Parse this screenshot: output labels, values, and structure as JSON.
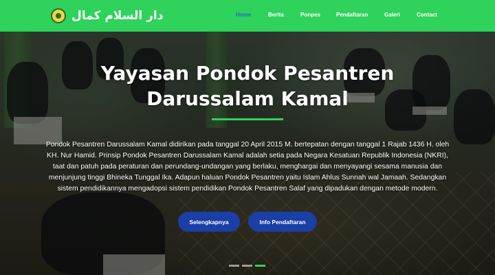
{
  "navbar": {
    "brand_text": "دار السلام كمال",
    "items": [
      {
        "label": "Home",
        "active": true
      },
      {
        "label": "Berita",
        "active": false
      },
      {
        "label": "Ponpes",
        "active": false
      },
      {
        "label": "Pendaftaran",
        "active": false
      },
      {
        "label": "Galeri",
        "active": false
      },
      {
        "label": "Contact",
        "active": false
      }
    ]
  },
  "hero": {
    "title_line1": "Yayasan Pondok Pesantren",
    "title_line2": "Darussalam Kamal",
    "description": "Pondok Pesantren Darussalam Kamal didirikan pada tanggal 20 April 2015 M. bertepatan dengan tanggal 1 Rajab 1436 H. oleh KH. Nur Hamid. Prinsip Pondok Pesantren Darussalam Kamal adalah setia pada Negara Kesatuan Republik Indonesia (NKRI), taat dan patuh pada peraturan dan perundang-undangan yang berlaku, menghargai dan menyayangi sesama manusia dan menjunjung tinggi Bhineka Tunggal Ika. Adapun haluan Pondok Pesantren yaitu Islam Ahlus Sunnah wal Jamaah. Sedangkan sistem pendidikannya mengadopsi sistem pendidikan Pondok Pesantren Salaf yang dipadukan dengan metode modern.",
    "button_primary": "Selengkapnya",
    "button_secondary": "Info Pendaftaran"
  },
  "slider": {
    "slide_count": 3,
    "active_index": 2
  },
  "colors": {
    "navbar_bg": "#2fd25a",
    "nav_active": "#1b6fd1",
    "button_bg": "#1a3fa6",
    "divider": "#2fd25a"
  }
}
